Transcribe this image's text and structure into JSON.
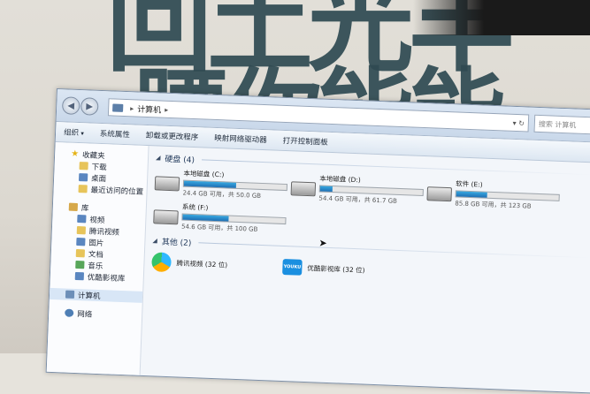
{
  "window": {
    "address": {
      "location": "计算机"
    },
    "search_placeholder": "搜索 计算机"
  },
  "toolbar": {
    "organize": "组织",
    "system_properties": "系统属性",
    "uninstall": "卸载或更改程序",
    "map_drive": "映射网络驱动器",
    "control_panel": "打开控制面板"
  },
  "sidebar": {
    "favorites": "收藏夹",
    "downloads": "下载",
    "desktop": "桌面",
    "recent": "最近访问的位置",
    "libraries": "库",
    "videos": "视频",
    "tencent_video": "腾讯视频",
    "pictures": "图片",
    "documents": "文档",
    "music": "音乐",
    "youku": "优酷影视库",
    "computer": "计算机",
    "network": "网络"
  },
  "hard_disks": {
    "header": "硬盘 (4)",
    "drives": [
      {
        "name": "本地磁盘 (C:)",
        "free_text": "24.4 GB 可用，共 50.0 GB",
        "used_fraction": 0.51
      },
      {
        "name": "本地磁盘 (D:)",
        "free_text": "54.4 GB 可用，共 61.7 GB",
        "used_fraction": 0.12
      },
      {
        "name": "软件 (E:)",
        "free_text": "85.8 GB 可用，共 123 GB",
        "used_fraction": 0.3
      },
      {
        "name": "系统 (F:)",
        "free_text": "54.6 GB 可用，共 100 GB",
        "used_fraction": 0.45
      }
    ]
  },
  "other": {
    "header": "其他 (2)",
    "items": [
      {
        "name": "腾讯视频 (32 位)"
      },
      {
        "name": "优酷影视库 (32 位)"
      }
    ]
  },
  "colors": {
    "capacity_bar": "#1f6fb4",
    "sidebar_bg": "#fbfcfe",
    "titlebar": "#c9d8ea"
  }
}
